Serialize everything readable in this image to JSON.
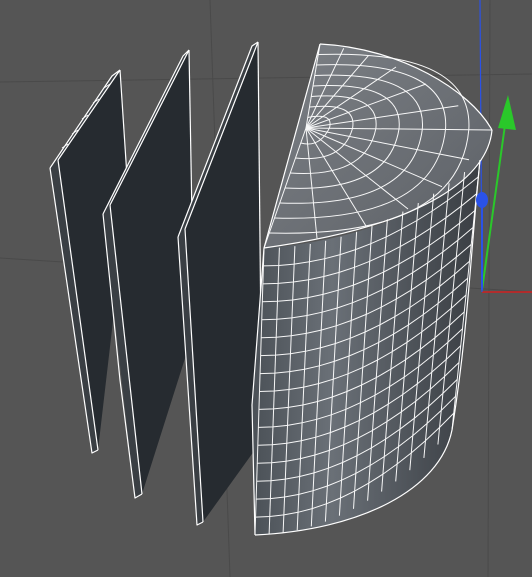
{
  "viewport": {
    "background": "#555555",
    "grid_color": "#4a4a4a",
    "wireframe_color": "#ffffff",
    "panel_face_color": "#262b30"
  },
  "axes": {
    "x_color": "#d02020",
    "y_color": "#2ac82a",
    "z_color": "#2a52e8"
  },
  "objects": [
    {
      "name": "panel-1",
      "shape": "thin-slab"
    },
    {
      "name": "panel-2",
      "shape": "thin-slab"
    },
    {
      "name": "panel-3",
      "shape": "thin-slab"
    },
    {
      "name": "half-cylinder",
      "shape": "half-cylinder"
    }
  ],
  "gizmo": {
    "handles": [
      "y-axis-arrow",
      "z-axis-arrow"
    ]
  }
}
